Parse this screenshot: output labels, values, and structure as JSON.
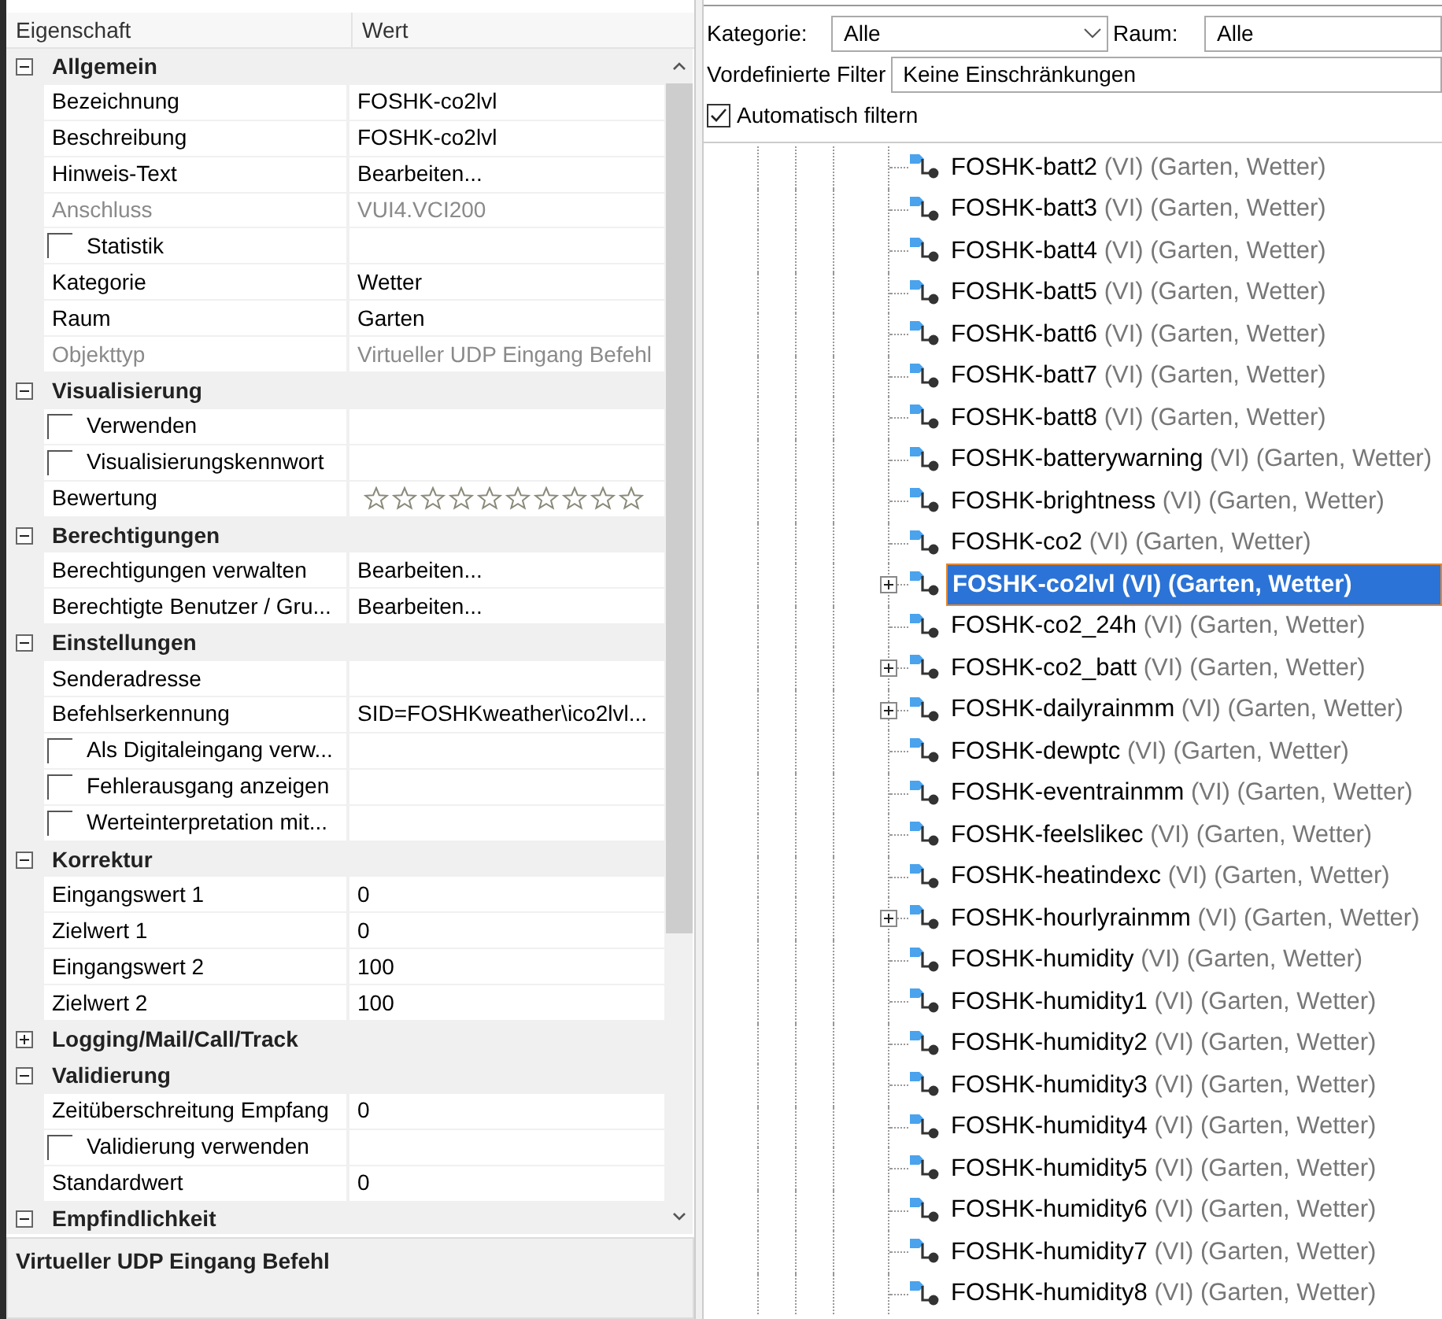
{
  "properties": {
    "columns": [
      "Eigenschaft",
      "Wert"
    ],
    "groups": [
      {
        "title": "Allgemein",
        "expanded": true,
        "rows": [
          {
            "kind": "text",
            "label": "Bezeichnung",
            "value": "FOSHK-co2lvl",
            "disabled": false
          },
          {
            "kind": "text",
            "label": "Beschreibung",
            "value": "FOSHK-co2lvl",
            "disabled": false
          },
          {
            "kind": "text",
            "label": "Hinweis-Text",
            "value": "Bearbeiten...",
            "disabled": false
          },
          {
            "kind": "text",
            "label": "Anschluss",
            "value": "VUI4.VCI200",
            "disabled": true
          },
          {
            "kind": "checkbox",
            "label": "Statistik",
            "checked": false
          },
          {
            "kind": "text",
            "label": "Kategorie",
            "value": "Wetter",
            "disabled": false
          },
          {
            "kind": "text",
            "label": "Raum",
            "value": "Garten",
            "disabled": false
          },
          {
            "kind": "text",
            "label": "Objekttyp",
            "value": "Virtueller UDP Eingang Befehl",
            "disabled": true
          }
        ]
      },
      {
        "title": "Visualisierung",
        "expanded": true,
        "rows": [
          {
            "kind": "checkbox",
            "label": "Verwenden",
            "checked": false
          },
          {
            "kind": "checkbox",
            "label": "Visualisierungskennwort",
            "checked": false
          },
          {
            "kind": "rating",
            "label": "Bewertung",
            "stars": 0
          }
        ]
      },
      {
        "title": "Berechtigungen",
        "expanded": true,
        "rows": [
          {
            "kind": "text",
            "label": "Berechtigungen verwalten",
            "value": "Bearbeiten...",
            "disabled": false
          },
          {
            "kind": "text",
            "label": "Berechtigte Benutzer / Gru...",
            "value": "Bearbeiten...",
            "disabled": false
          }
        ]
      },
      {
        "title": "Einstellungen",
        "expanded": true,
        "rows": [
          {
            "kind": "text",
            "label": "Senderadresse",
            "disabled": false
          },
          {
            "kind": "text",
            "label": "Befehlserkennung",
            "value": "SID=FOSHKweather\\ico2lvl...",
            "disabled": false
          },
          {
            "kind": "checkbox",
            "label": "Als Digitaleingang verw...",
            "checked": false
          },
          {
            "kind": "checkbox",
            "label": "Fehlerausgang anzeigen",
            "checked": false
          },
          {
            "kind": "checkbox",
            "label": "Werteinterpretation mit...",
            "checked": false
          }
        ]
      },
      {
        "title": "Korrektur",
        "expanded": true,
        "rows": [
          {
            "kind": "text",
            "label": "Eingangswert 1",
            "value": "0",
            "disabled": false
          },
          {
            "kind": "text",
            "label": "Zielwert 1",
            "value": "0",
            "disabled": false
          },
          {
            "kind": "text",
            "label": "Eingangswert 2",
            "value": "100",
            "disabled": false
          },
          {
            "kind": "text",
            "label": "Zielwert 2",
            "value": "100",
            "disabled": false
          }
        ]
      },
      {
        "title": "Logging/Mail/Call/Track",
        "expanded": false
      },
      {
        "title": "Validierung",
        "expanded": true,
        "rows": [
          {
            "kind": "text",
            "label": "Zeitüberschreitung Empfang",
            "value": "0",
            "disabled": false
          },
          {
            "kind": "checkbox",
            "label": "Validierung verwenden",
            "checked": false
          },
          {
            "kind": "text",
            "label": "Standardwert",
            "value": "0",
            "disabled": false
          }
        ]
      },
      {
        "title": "Empfindlichkeit",
        "expanded": true
      }
    ],
    "description": "Virtueller UDP Eingang Befehl"
  },
  "filters": {
    "category": {
      "label": "Kategorie:",
      "value": "Alle"
    },
    "room": {
      "label": "Raum:",
      "value": "Alle"
    },
    "predefined": {
      "label": "Vordefinierte Filter",
      "value": "Keine Einschränkungen"
    },
    "auto_filter": {
      "label": "Automatisch filtern",
      "checked": true
    }
  },
  "tree": {
    "items": [
      {
        "name": "FOSHK-batt2",
        "type": "(VI)",
        "location": "(Garten, Wetter)",
        "has_children": false,
        "selected": false
      },
      {
        "name": "FOSHK-batt3",
        "type": "(VI)",
        "location": "(Garten, Wetter)",
        "has_children": false,
        "selected": false
      },
      {
        "name": "FOSHK-batt4",
        "type": "(VI)",
        "location": "(Garten, Wetter)",
        "has_children": false,
        "selected": false
      },
      {
        "name": "FOSHK-batt5",
        "type": "(VI)",
        "location": "(Garten, Wetter)",
        "has_children": false,
        "selected": false
      },
      {
        "name": "FOSHK-batt6",
        "type": "(VI)",
        "location": "(Garten, Wetter)",
        "has_children": false,
        "selected": false
      },
      {
        "name": "FOSHK-batt7",
        "type": "(VI)",
        "location": "(Garten, Wetter)",
        "has_children": false,
        "selected": false
      },
      {
        "name": "FOSHK-batt8",
        "type": "(VI)",
        "location": "(Garten, Wetter)",
        "has_children": false,
        "selected": false
      },
      {
        "name": "FOSHK-batterywarning",
        "type": "(VI)",
        "location": "(Garten, Wetter)",
        "has_children": false,
        "selected": false
      },
      {
        "name": "FOSHK-brightness",
        "type": "(VI)",
        "location": "(Garten, Wetter)",
        "has_children": false,
        "selected": false
      },
      {
        "name": "FOSHK-co2",
        "type": "(VI)",
        "location": "(Garten, Wetter)",
        "has_children": false,
        "selected": false
      },
      {
        "name": "FOSHK-co2lvl",
        "type": "(VI)",
        "location": "(Garten, Wetter)",
        "has_children": true,
        "selected": true
      },
      {
        "name": "FOSHK-co2_24h",
        "type": "(VI)",
        "location": "(Garten, Wetter)",
        "has_children": false,
        "selected": false
      },
      {
        "name": "FOSHK-co2_batt",
        "type": "(VI)",
        "location": "(Garten, Wetter)",
        "has_children": true,
        "selected": false
      },
      {
        "name": "FOSHK-dailyrainmm",
        "type": "(VI)",
        "location": "(Garten, Wetter)",
        "has_children": true,
        "selected": false
      },
      {
        "name": "FOSHK-dewptc",
        "type": "(VI)",
        "location": "(Garten, Wetter)",
        "has_children": false,
        "selected": false
      },
      {
        "name": "FOSHK-eventrainmm",
        "type": "(VI)",
        "location": "(Garten, Wetter)",
        "has_children": false,
        "selected": false
      },
      {
        "name": "FOSHK-feelslikec",
        "type": "(VI)",
        "location": "(Garten, Wetter)",
        "has_children": false,
        "selected": false
      },
      {
        "name": "FOSHK-heatindexc",
        "type": "(VI)",
        "location": "(Garten, Wetter)",
        "has_children": false,
        "selected": false
      },
      {
        "name": "FOSHK-hourlyrainmm",
        "type": "(VI)",
        "location": "(Garten, Wetter)",
        "has_children": true,
        "selected": false
      },
      {
        "name": "FOSHK-humidity",
        "type": "(VI)",
        "location": "(Garten, Wetter)",
        "has_children": false,
        "selected": false
      },
      {
        "name": "FOSHK-humidity1",
        "type": "(VI)",
        "location": "(Garten, Wetter)",
        "has_children": false,
        "selected": false
      },
      {
        "name": "FOSHK-humidity2",
        "type": "(VI)",
        "location": "(Garten, Wetter)",
        "has_children": false,
        "selected": false
      },
      {
        "name": "FOSHK-humidity3",
        "type": "(VI)",
        "location": "(Garten, Wetter)",
        "has_children": false,
        "selected": false
      },
      {
        "name": "FOSHK-humidity4",
        "type": "(VI)",
        "location": "(Garten, Wetter)",
        "has_children": false,
        "selected": false
      },
      {
        "name": "FOSHK-humidity5",
        "type": "(VI)",
        "location": "(Garten, Wetter)",
        "has_children": false,
        "selected": false
      },
      {
        "name": "FOSHK-humidity6",
        "type": "(VI)",
        "location": "(Garten, Wetter)",
        "has_children": false,
        "selected": false
      },
      {
        "name": "FOSHK-humidity7",
        "type": "(VI)",
        "location": "(Garten, Wetter)",
        "has_children": false,
        "selected": false
      },
      {
        "name": "FOSHK-humidity8",
        "type": "(VI)",
        "location": "(Garten, Wetter)",
        "has_children": false,
        "selected": false
      }
    ]
  }
}
